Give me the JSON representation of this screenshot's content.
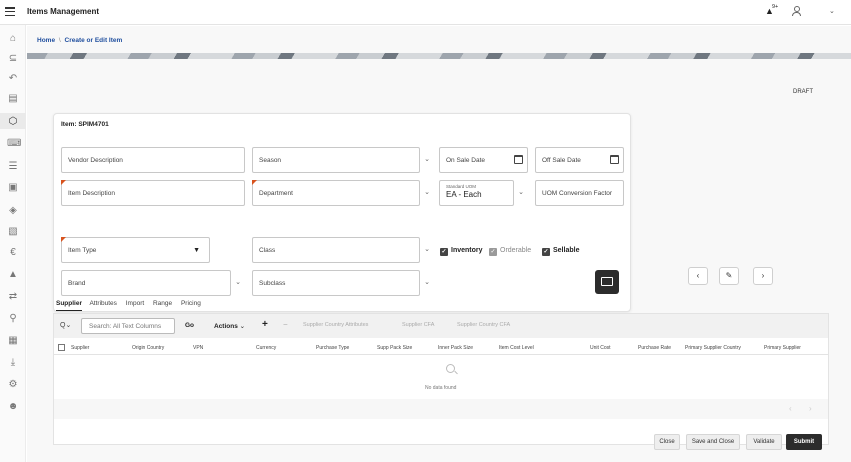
{
  "header": {
    "title": "Items Management",
    "bell_count": "9+"
  },
  "breadcrumb": {
    "home": "Home",
    "separator": "\\",
    "current": "Create or Edit Item"
  },
  "status": {
    "draft": "DRAFT"
  },
  "item": {
    "title": "Item: SPIM4701"
  },
  "form": {
    "vendor_description": "Vendor Description",
    "season": "Season",
    "on_sale_date": "On Sale Date",
    "off_sale_date": "Off Sale Date",
    "item_description": "Item Description",
    "department": "Department",
    "standard_uom_label": "Standard UOM",
    "standard_uom_value": "EA - Each",
    "uom_conversion_factor": "UOM Conversion Factor",
    "item_type": "Item Type",
    "class": "Class",
    "inventory": "Inventory",
    "orderable": "Orderable",
    "sellable": "Sellable",
    "brand": "Brand",
    "subclass": "Subclass"
  },
  "tabs": [
    {
      "label": "Supplier",
      "active": true
    },
    {
      "label": "Attributes"
    },
    {
      "label": "Import"
    },
    {
      "label": "Range"
    },
    {
      "label": "Pricing"
    }
  ],
  "toolbar": {
    "search_placeholder": "Search: All Text Columns",
    "go": "Go",
    "actions": "Actions",
    "add": "+",
    "remove": "−",
    "supplier_country_attributes": "Supplier Country Attributes",
    "supplier_cfa": "Supplier CFA",
    "supplier_country_cfa": "Supplier Country CFA"
  },
  "table": {
    "columns": [
      "Supplier",
      "Origin Country",
      "VPN",
      "Currency",
      "Purchase Type",
      "Supp Pack Size",
      "Inner Pack Size",
      "Item Cost Level",
      "Unit Cost",
      "Purchase Rate",
      "Primary Supplier Country",
      "Primary Supplier"
    ],
    "empty_text": "No data found"
  },
  "footer": {
    "close": "Close",
    "save_and_close": "Save and Close",
    "validate": "Validate",
    "submit": "Submit"
  },
  "colors": {
    "accent": "#1f6feb",
    "required": "#d8531e",
    "submit_bg": "#2c2c2c"
  }
}
